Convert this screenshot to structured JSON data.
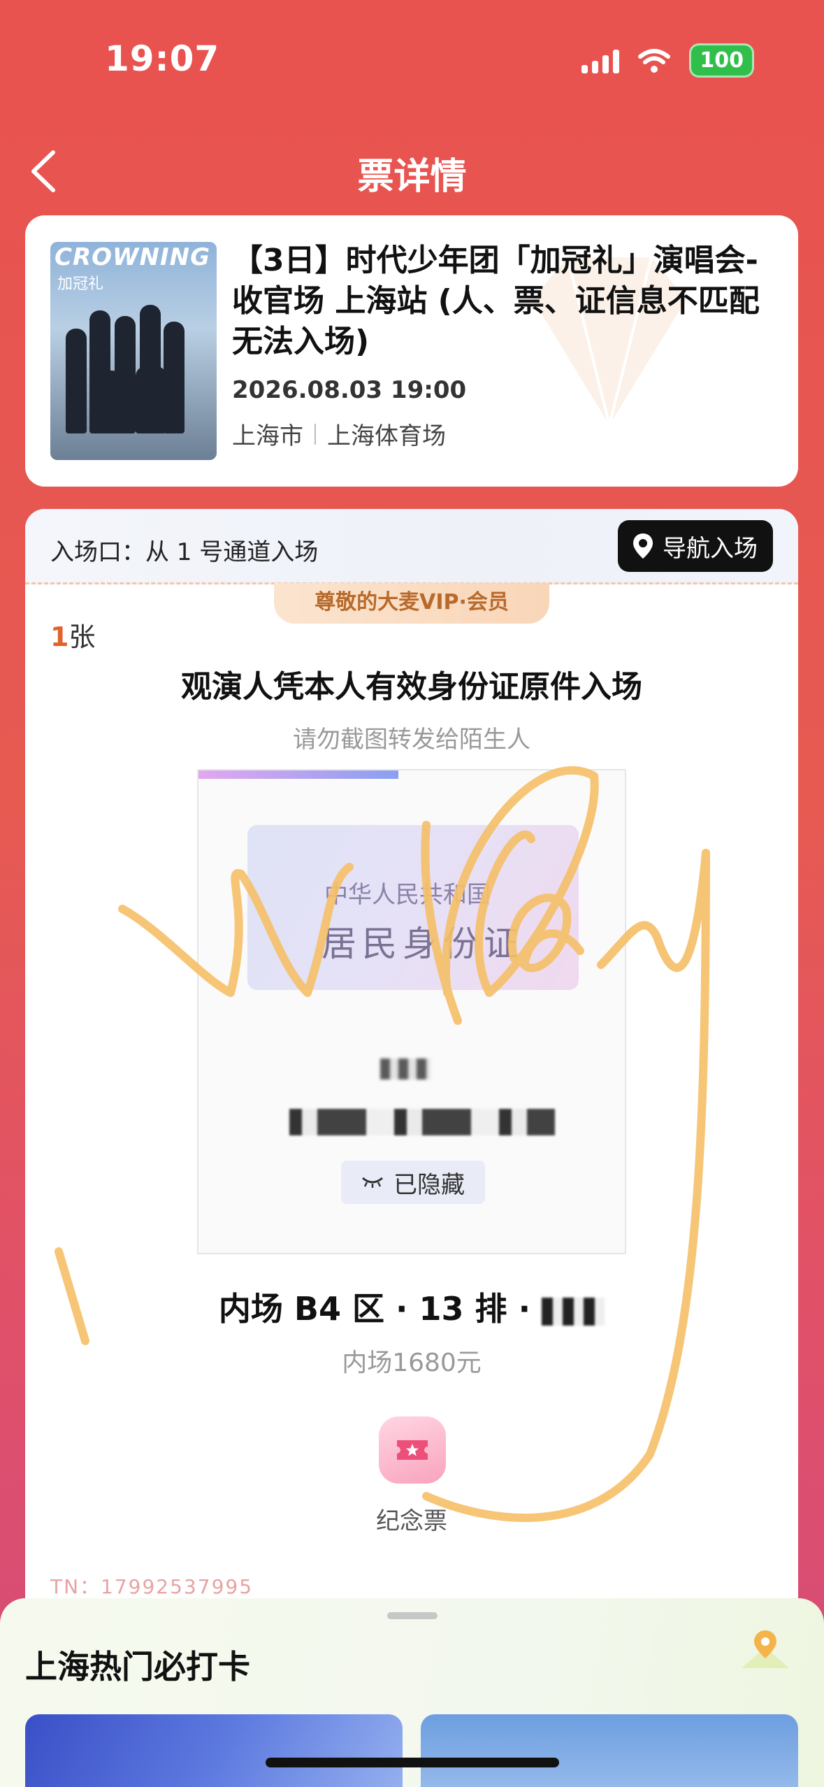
{
  "status_bar": {
    "time": "19:07",
    "battery": "100"
  },
  "nav": {
    "title": "票详情"
  },
  "event": {
    "poster_title": "CROWNING",
    "poster_subtitle": "加冠礼",
    "title": "【3日】时代少年团「加冠礼」演唱会-收官场 上海站 (人、票、证信息不匹配无法入场)",
    "datetime": "2026.08.03 19:00",
    "city": "上海市",
    "venue": "上海体育场"
  },
  "ticket": {
    "entrance": "入场口：从 1 号通道入场",
    "navigate_label": "导航入场",
    "vip_badge": "尊敬的大麦VIP·会员",
    "count_num": "1",
    "count_unit": "张",
    "notice": "观演人凭本人有效身份证原件入场",
    "notice_sub": "请勿截图转发给陌生人",
    "id_line1": "中华人民共和国",
    "id_line2": "居民身份证",
    "hidden_label": "已隐藏",
    "seat": "内场 B4 区 · 13 排 ·",
    "price": "内场1680元",
    "souvenir_label": "纪念票",
    "tn": "TN：17992537995"
  },
  "sheet": {
    "title": "上海热门必打卡"
  },
  "colors": {
    "accent": "#e8524f",
    "vip_text": "#b86a2b",
    "count": "#e2622c",
    "scribble": "#f5c06a"
  }
}
